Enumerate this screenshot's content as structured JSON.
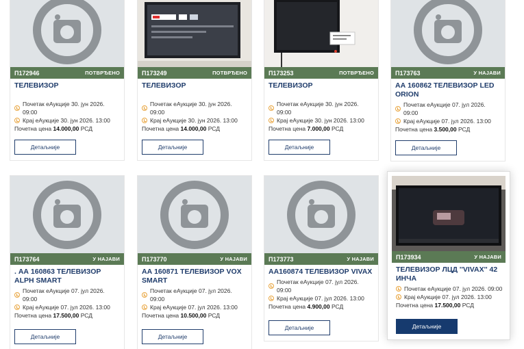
{
  "cards": [
    {
      "code": "П172946",
      "status": "ПОТВРЂЕНО",
      "title": "ТЕЛЕВИЗОР",
      "start": "Почетак еАукције 30. јун 2026. 09:00",
      "end": "Крај еАукције 30. јун 2026. 13:00",
      "price_label": "Почетна цена",
      "price": "14.000,00",
      "currency": "РСД",
      "button": "Детаљније",
      "image": "placeholder"
    },
    {
      "code": "П173249",
      "status": "ПОТВРЂЕНО",
      "title": "ТЕЛЕВИЗОР",
      "start": "Почетак еАукције 30. јун 2026. 09:00",
      "end": "Крај еАукције 30. јун 2026. 13:00",
      "price_label": "Почетна цена",
      "price": "14.000,00",
      "currency": "РСД",
      "button": "Детаљније",
      "image": "photo"
    },
    {
      "code": "П173253",
      "status": "ПОТВРЂЕНО",
      "title": "ТЕЛЕВИЗОР",
      "start": "Почетак еАукције 30. јун 2026. 09:00",
      "end": "Крај еАукције 30. јун 2026. 13:00",
      "price_label": "Почетна цена",
      "price": "7.000,00",
      "currency": "РСД",
      "button": "Детаљније",
      "image": "photo"
    },
    {
      "code": "П173763",
      "status": "У НАЈАВИ",
      "title": "АА 160862 ТЕЛЕВИЗОР LED ORION",
      "start": "Почетак еАукције 07. јул 2026. 09:00",
      "end": "Крај еАукције 07. јул 2026. 13:00",
      "price_label": "Почетна цена",
      "price": "3.500,00",
      "currency": "РСД",
      "button": "Детаљније",
      "image": "placeholder"
    },
    {
      "code": "П173764",
      "status": "У НАЈАВИ",
      "title": ". АА 160863 ТЕЛЕВИЗОР ALPH SMART",
      "start": "Почетак еАукције 07. јул 2026. 09:00",
      "end": "Крај еАукције 07. јул 2026. 13:00",
      "price_label": "Почетна цена",
      "price": "17.500,00",
      "currency": "РСД",
      "button": "Детаљније",
      "image": "placeholder"
    },
    {
      "code": "П173770",
      "status": "У НАЈАВИ",
      "title": "АА 160871 ТЕЛЕВИЗОР VOX SMART",
      "start": "Почетак еАукције 07. јул 2026. 09:00",
      "end": "Крај еАукције 07. јул 2026. 13:00",
      "price_label": "Почетна цена",
      "price": "10.500,00",
      "currency": "РСД",
      "button": "Детаљније",
      "image": "placeholder"
    },
    {
      "code": "П173773",
      "status": "У НАЈАВИ",
      "title": "АА160874 ТЕЛЕВИЗОР VIVAX",
      "start": "Почетак еАукције 07. јул 2026. 09:00",
      "end": "Крај еАукције 07. јул 2026. 13:00",
      "price_label": "Почетна цена",
      "price": "4.900,00",
      "currency": "РСД",
      "button": "Детаљније",
      "image": "placeholder"
    },
    {
      "code": "П173934",
      "status": "У НАЈАВИ",
      "title": "ТЕЛЕВИЗОР ЛЦД ''VIVAX'' 42 ИНЧА",
      "start": "Почетак еАукције 07. јул 2026. 09:00",
      "end": "Крај еАукције 07. јул 2026. 13:00",
      "price_label": "Почетна цена",
      "price": "17.500,00",
      "currency": "РСД",
      "button": "Детаљније",
      "image": "photo"
    }
  ]
}
